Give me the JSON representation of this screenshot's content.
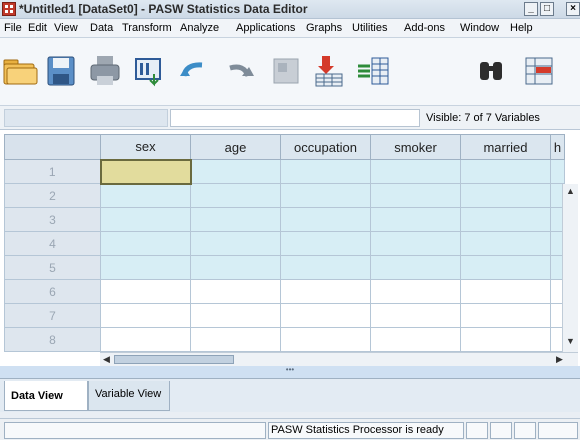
{
  "window": {
    "title": "*Untitled1 [DataSet0] - PASW Statistics Data Editor",
    "controls": {
      "minimize": "_",
      "maximize": "□",
      "close": "×"
    }
  },
  "menu": [
    "File",
    "Edit",
    "View",
    "Data",
    "Transform",
    "Analyze",
    "Applications",
    "Graphs",
    "Utilities",
    "Add-ons",
    "Window",
    "Help"
  ],
  "toolbar": [
    "open-folder-icon",
    "save-icon",
    "print-icon",
    "recall-dialog-icon",
    "undo-icon",
    "redo-icon",
    "goto-case-icon",
    "goto-variable-icon",
    "variables-icon",
    "find-icon",
    "insert-cases-icon"
  ],
  "cell_editor": {
    "name": "",
    "value": ""
  },
  "visible_label": "Visible: 7 of 7 Variables",
  "columns": [
    "sex",
    "age",
    "occupation",
    "smoker",
    "married",
    "h"
  ],
  "rows": [
    "1",
    "2",
    "3",
    "4",
    "5",
    "6",
    "7",
    "8"
  ],
  "tabs": {
    "data_view": "Data View",
    "variable_view": "Variable View"
  },
  "splitter_glyph": "•••",
  "status": {
    "processor": "PASW Statistics Processor is ready"
  },
  "colors": {
    "accent": "#1f5ea8",
    "active_cell": "#e2dc9d",
    "filled_row": "#d7eef5"
  }
}
